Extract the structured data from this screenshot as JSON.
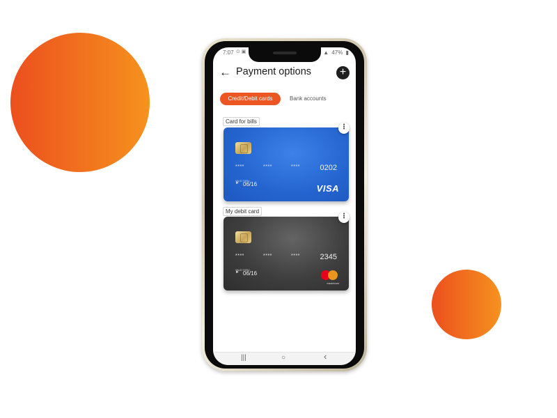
{
  "status_bar": {
    "time": "7:07",
    "left_icons": "⊙ ▣",
    "right_icons": [
      "✻",
      "◉",
      "⌯",
      "▲"
    ],
    "battery": "47%",
    "battery_icon": "▮"
  },
  "header": {
    "back_icon": "←",
    "title": "Payment options",
    "add_icon": "+"
  },
  "tabs": [
    {
      "label": "Credit/Debit cards",
      "active": true
    },
    {
      "label": "Bank accounts",
      "active": false
    }
  ],
  "cards": [
    {
      "label": "Card for bills",
      "masked": [
        "****",
        "****",
        "****"
      ],
      "last4": "0202",
      "valid_label": "VALID THRU",
      "valid_arrow": "►",
      "expiry": "06/16",
      "brand": "VISA",
      "color": "#2464cf"
    },
    {
      "label": "My debit card",
      "masked": [
        "****",
        "****",
        "****"
      ],
      "last4": "2345",
      "valid_label": "VALID THRU",
      "valid_arrow": "►",
      "expiry": "06/16",
      "brand": "mastercard",
      "color": "#3e3e3e"
    }
  ],
  "menu_icon": "⋮",
  "nav_bar": {
    "recents_icon": "|||",
    "home_icon": "○",
    "back_icon": "‹"
  },
  "colors": {
    "accent": "#ec5622",
    "blob_gradient_start": "#ec4f1e",
    "blob_gradient_end": "#f6921e"
  }
}
